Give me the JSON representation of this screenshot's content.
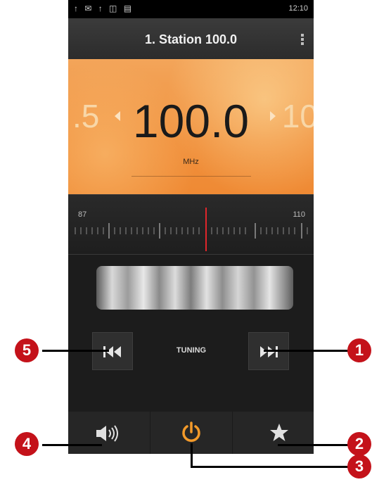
{
  "status_bar": {
    "left_icons": "↑ ✉ ↑ ◫ ▤",
    "time": "12:10"
  },
  "title": "1. Station 100.0",
  "frequency": {
    "previous": ".5",
    "current": "100.0",
    "next": "10",
    "unit": "MHz"
  },
  "scale": {
    "min": "87",
    "max": "110"
  },
  "tuning_label": "TUNING",
  "callouts": {
    "next": "1",
    "favorite": "2",
    "power": "3",
    "speaker": "4",
    "previous": "5"
  },
  "colors": {
    "accent_orange": "#f08f3b",
    "needle": "#e0262b",
    "callout": "#c4121a",
    "power_icon": "#f39a2a"
  }
}
